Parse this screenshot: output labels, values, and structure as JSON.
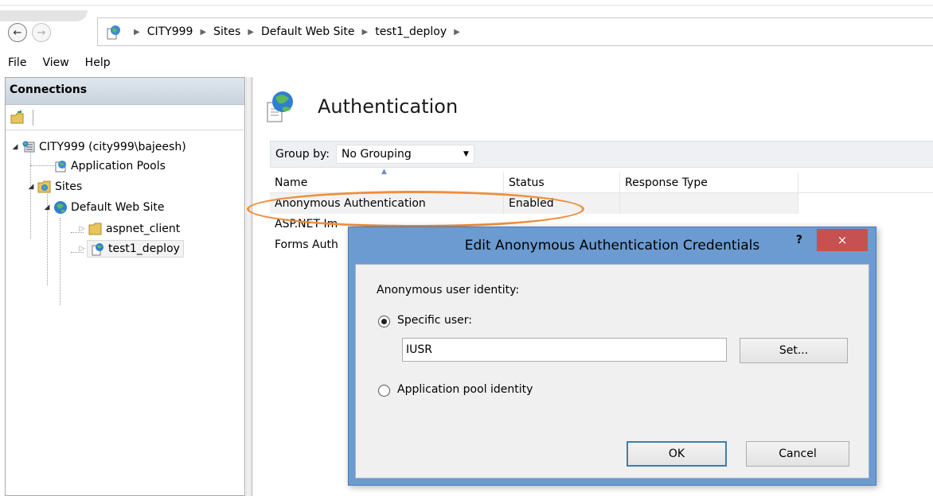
{
  "address": {
    "crumbs": [
      "CITY999",
      "Sites",
      "Default Web Site",
      "test1_deploy"
    ]
  },
  "menu": [
    "File",
    "View",
    "Help"
  ],
  "connections": {
    "title": "Connections",
    "tree": {
      "server": "CITY999 (city999\\bajeesh)",
      "app_pools": "Application Pools",
      "sites": "Sites",
      "default_site": "Default Web Site",
      "aspnet_client": "aspnet_client",
      "test1_deploy": "test1_deploy"
    }
  },
  "main": {
    "title": "Authentication",
    "group_by_label": "Group by:",
    "group_by_value": "No Grouping",
    "columns": [
      "Name",
      "Status",
      "Response Type"
    ],
    "rows": [
      {
        "name": "Anonymous Authentication",
        "status": "Enabled",
        "response": ""
      },
      {
        "name": "ASP.NET Im",
        "status": "",
        "response": ""
      },
      {
        "name": "Forms Auth",
        "status": "",
        "response": ""
      }
    ]
  },
  "dialog": {
    "title": "Edit Anonymous Authentication Credentials",
    "help": "?",
    "close": "×",
    "identity_label": "Anonymous user identity:",
    "specific_user_label": "Specific user:",
    "specific_user_value": "IUSR",
    "set_button": "Set...",
    "app_pool_label": "Application pool identity",
    "ok": "OK",
    "cancel": "Cancel"
  },
  "colors": {
    "highlight_ellipse": "#ef8f3c",
    "dialog_frame": "#6b9bd1",
    "close_button": "#c75050"
  }
}
